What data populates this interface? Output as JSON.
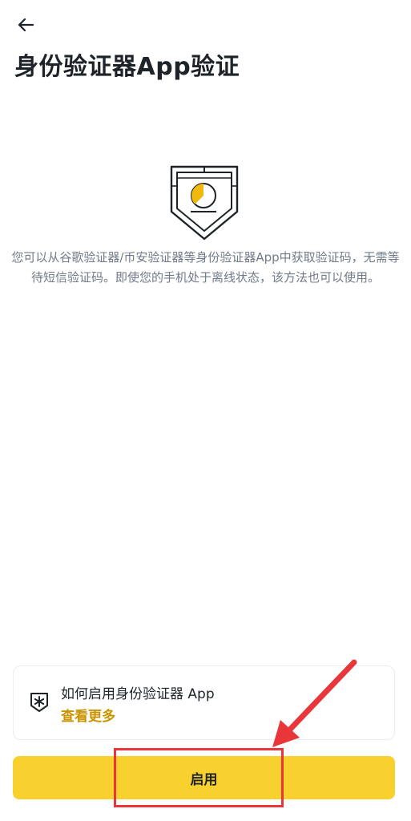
{
  "header": {
    "back_icon": "arrow-left-icon",
    "title": "身份验证器App验证"
  },
  "hero": {
    "icon": "authenticator-shield-icon",
    "accent_color": "#f0b90b"
  },
  "description": "您可以从谷歌验证器/币安验证器等身份验证器App中获取验证码，无需等待短信验证码。即使您的手机处于离线状态，该方法也可以使用。",
  "guide_card": {
    "icon": "asterisk-shield-icon",
    "title": "如何启用身份验证器 App",
    "link_label": "查看更多",
    "link_color": "#c99400"
  },
  "primary_button": {
    "label": "启用",
    "background": "#f8d12f"
  },
  "annotation": {
    "color": "#e8363a",
    "target": "primary_button"
  }
}
